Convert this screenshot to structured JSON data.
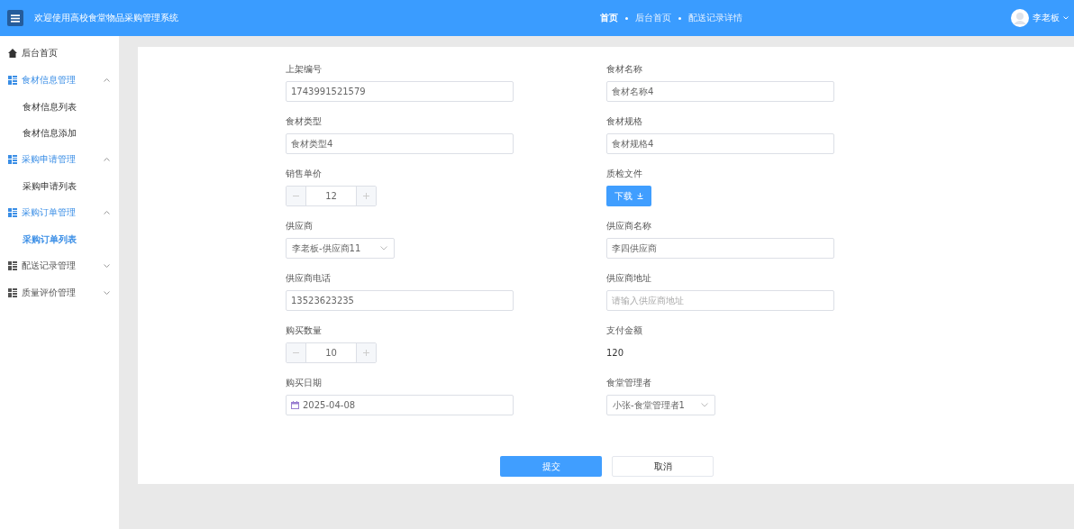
{
  "header": {
    "title": "欢迎使用高校食堂物品采购管理系统",
    "breadcrumbs": [
      {
        "label": "首页",
        "selected": true
      },
      {
        "label": "后台首页",
        "selected": false
      },
      {
        "label": "配送记录详情",
        "selected": false
      }
    ],
    "user": {
      "name": "李老板"
    }
  },
  "sidebar": {
    "items": [
      {
        "label": "后台首页",
        "kind": "home"
      },
      {
        "label": "食材信息管理",
        "kind": "group",
        "expanded": true,
        "children": [
          {
            "label": "食材信息列表",
            "selected": false
          },
          {
            "label": "食材信息添加",
            "selected": false
          }
        ]
      },
      {
        "label": "采购申请管理",
        "kind": "group",
        "expanded": true,
        "children": [
          {
            "label": "采购申请列表",
            "selected": false
          }
        ]
      },
      {
        "label": "采购订单管理",
        "kind": "group",
        "expanded": true,
        "children": [
          {
            "label": "采购订单列表",
            "selected": true
          }
        ]
      },
      {
        "label": "配送记录管理",
        "kind": "group",
        "expanded": false
      },
      {
        "label": "质量评价管理",
        "kind": "group",
        "expanded": false
      }
    ]
  },
  "form": {
    "fields": [
      {
        "label": "上架编号",
        "kind": "input",
        "value": "1743991521579"
      },
      {
        "label": "食材名称",
        "kind": "input",
        "value": "食材名称4"
      },
      {
        "label": "食材类型",
        "kind": "input",
        "value": "食材类型4"
      },
      {
        "label": "食材规格",
        "kind": "input",
        "value": "食材规格4"
      },
      {
        "label": "销售单价",
        "kind": "number",
        "value": "12"
      },
      {
        "label": "质检文件",
        "kind": "button",
        "value": "下载"
      },
      {
        "label": "供应商",
        "kind": "select",
        "value": "李老板-供应商11"
      },
      {
        "label": "供应商名称",
        "kind": "input",
        "value": "李四供应商"
      },
      {
        "label": "供应商电话",
        "kind": "input",
        "value": "13523623235"
      },
      {
        "label": "供应商地址",
        "kind": "input",
        "placeholder": "请输入供应商地址"
      },
      {
        "label": "购买数量",
        "kind": "number",
        "value": "10"
      },
      {
        "label": "支付金额",
        "kind": "text",
        "value": "120"
      },
      {
        "label": "购买日期",
        "kind": "date",
        "value": "2025-04-08"
      },
      {
        "label": "食堂管理者",
        "kind": "select",
        "value": "小张-食堂管理者1"
      }
    ],
    "buttons": [
      {
        "label": "提交",
        "kind": "primary"
      },
      {
        "label": "取消",
        "kind": "plain"
      }
    ]
  }
}
